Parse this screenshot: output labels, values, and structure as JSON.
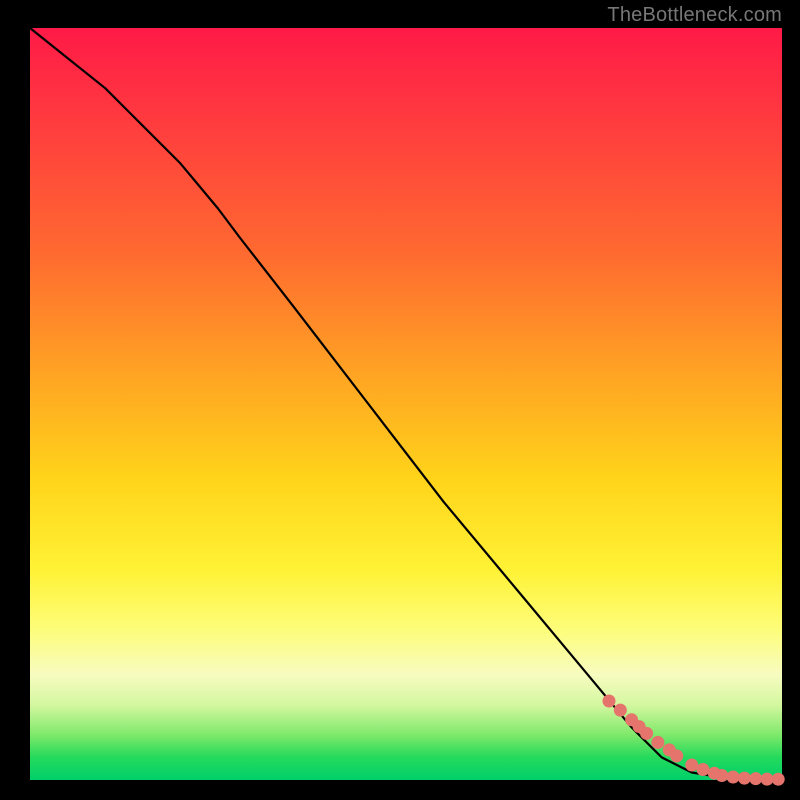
{
  "watermark": "TheBottleneck.com",
  "colors": {
    "background": "#000000",
    "curve": "#000000",
    "marker": "#e5746c",
    "gradient_top": "#ff1a47",
    "gradient_bottom": "#00cf6a"
  },
  "chart_data": {
    "type": "line",
    "title": "",
    "xlabel": "",
    "ylabel": "",
    "xlim": [
      0,
      100
    ],
    "ylim": [
      0,
      100
    ],
    "series": [
      {
        "name": "curve",
        "x": [
          0,
          5,
          10,
          15,
          20,
          25,
          28,
          35,
          45,
          55,
          65,
          75,
          80,
          84,
          88,
          91,
          93,
          95,
          97,
          100
        ],
        "y": [
          100,
          96,
          92,
          87,
          82,
          76,
          72,
          63,
          50,
          37,
          25,
          13,
          7,
          3,
          1,
          0.5,
          0.3,
          0.2,
          0.1,
          0.1
        ]
      }
    ],
    "markers": {
      "name": "highlighted-points",
      "x": [
        77,
        78.5,
        80,
        81,
        82,
        83.5,
        85,
        86,
        88,
        89.5,
        91,
        92,
        93.5,
        95,
        96.5,
        98,
        99.5
      ],
      "y": [
        10.5,
        9.3,
        8.0,
        7.1,
        6.2,
        5.0,
        4.0,
        3.2,
        2.0,
        1.4,
        0.9,
        0.6,
        0.4,
        0.25,
        0.18,
        0.12,
        0.1
      ]
    }
  }
}
